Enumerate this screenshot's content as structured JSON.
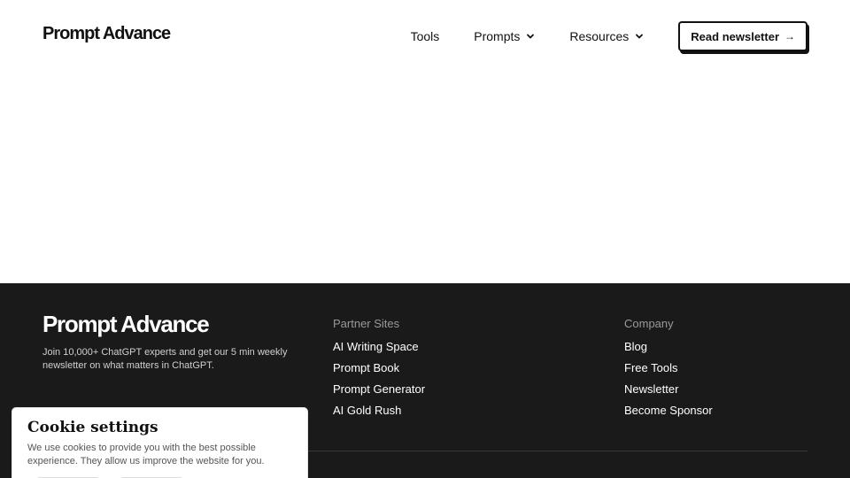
{
  "header": {
    "logo": "Prompt Advance",
    "nav": {
      "tools": "Tools",
      "prompts": "Prompts",
      "resources": "Resources"
    },
    "cta": {
      "label": "Read newsletter",
      "arrow": "→"
    }
  },
  "footer": {
    "logo": "Prompt Advance",
    "description": "Join 10,000+ ChatGPT experts and get our 5 min weekly newsletter on what matters in ChatGPT.",
    "partner_sites": {
      "heading": "Partner Sites",
      "links": [
        "AI Writing Space",
        "Prompt Book",
        "Prompt Generator",
        "AI Gold Rush"
      ]
    },
    "company": {
      "heading": "Company",
      "links": [
        "Blog",
        "Free Tools",
        "Newsletter",
        "Become Sponsor"
      ]
    }
  },
  "cookie": {
    "title": "Cookie settings",
    "text": "We use cookies to provide you with the best possible experience. They allow us improve the website for you."
  },
  "colors": {
    "footer_bg": "#1a1a1a",
    "text_dark": "#111111",
    "muted": "#9a9a9a"
  },
  "icons": {
    "dropdown": "chevron-down-icon",
    "cta_arrow": "arrow-right-icon"
  }
}
